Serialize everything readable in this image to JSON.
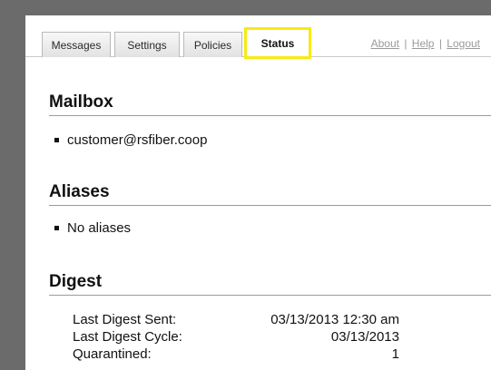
{
  "tabs": [
    {
      "label": "Messages"
    },
    {
      "label": "Settings"
    },
    {
      "label": "Policies"
    },
    {
      "label": "Status",
      "active": true
    }
  ],
  "top_links": {
    "about": "About",
    "help": "Help",
    "logout": "Logout",
    "separator": "|"
  },
  "mailbox": {
    "title": "Mailbox",
    "items": [
      "customer@rsfiber.coop"
    ]
  },
  "aliases": {
    "title": "Aliases",
    "items": [
      "No aliases"
    ]
  },
  "digest": {
    "title": "Digest",
    "rows": [
      {
        "label": "Last Digest Sent:",
        "value": "03/13/2013 12:30 am"
      },
      {
        "label": "Last Digest Cycle:",
        "value": "03/13/2013"
      },
      {
        "label": "Quarantined:",
        "value": "1"
      }
    ]
  },
  "colors": {
    "highlight": "#f7ea14",
    "background": "#6b6b6b",
    "link": "#9a9a9a"
  }
}
